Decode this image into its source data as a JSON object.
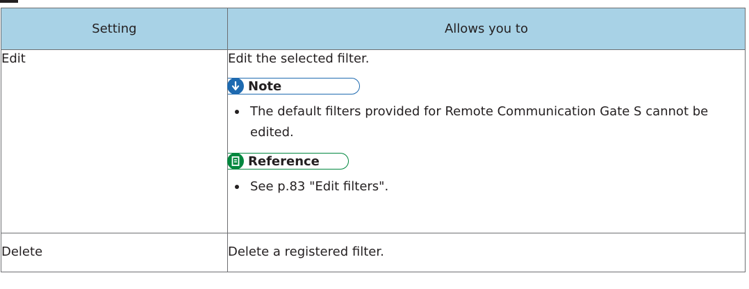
{
  "table": {
    "headers": [
      "Setting",
      "Allows you to"
    ],
    "rows": [
      {
        "setting": "Edit",
        "description": "Edit the selected filter.",
        "note": {
          "label": "Note",
          "items": [
            "The default filters provided for Remote Communication Gate S cannot be edited."
          ]
        },
        "reference": {
          "label": "Reference",
          "items": [
            "See p.83 \"Edit filters\"."
          ]
        }
      },
      {
        "setting": "Delete",
        "description": "Delete a registered filter."
      }
    ]
  },
  "icons": {
    "note_icon": "down-arrow-icon",
    "reference_icon": "document-icon"
  },
  "colors": {
    "header_bg": "#a8d2e6",
    "note_accent": "#1e6ab0",
    "reference_accent": "#00873e"
  }
}
